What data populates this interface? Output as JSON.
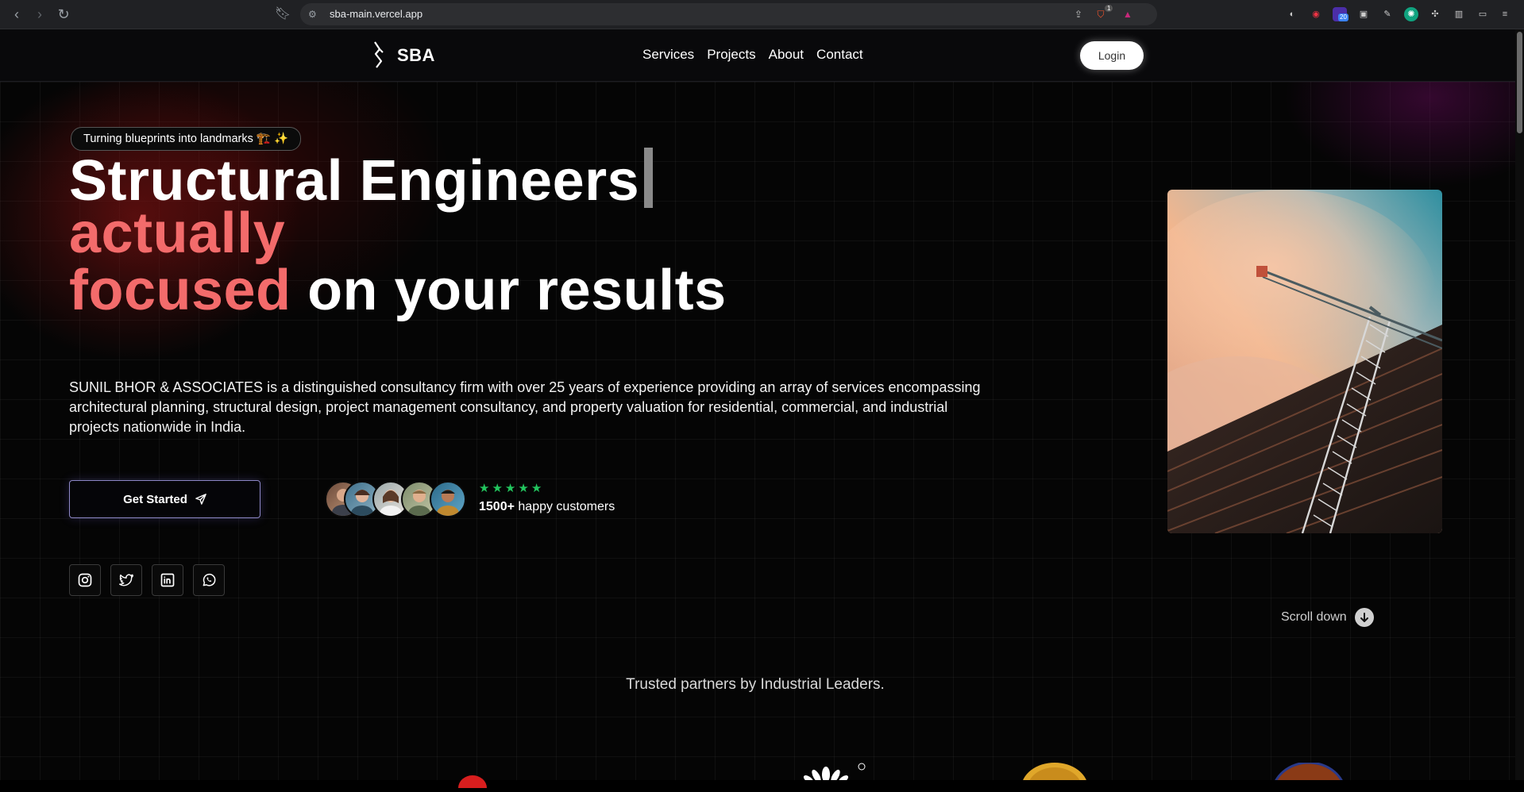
{
  "browser": {
    "url": "sba-main.vercel.app",
    "brave_badge": "1",
    "extension_badge": "20"
  },
  "header": {
    "logo_text": "SBA",
    "nav": [
      "Services",
      "Projects",
      "About",
      "Contact"
    ],
    "login_label": "Login"
  },
  "hero": {
    "tagline": "Turning blueprints into landmarks 🏗️ ✨",
    "headline_line1": "Structural Engineers",
    "headline_line2": "actually",
    "headline_line3_red": "focused",
    "headline_line3_white": "on your results",
    "description": "SUNIL BHOR & ASSOCIATES is a distinguished consultancy firm with over 25 years of experience providing an array of services encompassing architectural planning, structural design, project management consultancy, and property valuation for residential, commercial, and industrial projects nationwide in India.",
    "cta_label": "Get Started",
    "rating_stars": 5,
    "customers_count": "1500+",
    "customers_text": "happy customers",
    "socials": [
      "instagram-icon",
      "twitter-icon",
      "linkedin-icon",
      "whatsapp-icon"
    ],
    "scroll_label": "Scroll down"
  },
  "partners": {
    "heading": "Trusted partners by Industrial Leaders."
  },
  "colors": {
    "accent_red": "#f36b6b",
    "star_green": "#22c55e",
    "cta_border": "#8e88c7"
  }
}
